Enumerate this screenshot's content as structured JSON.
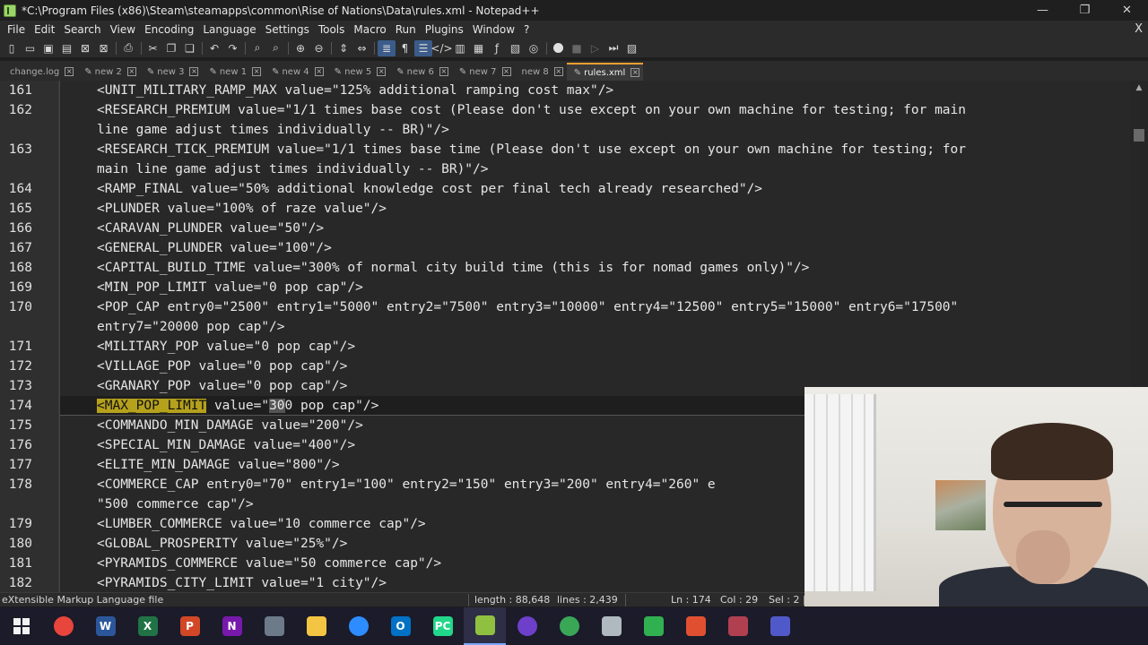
{
  "window": {
    "title": "*C:\\Program Files (x86)\\Steam\\steamapps\\common\\Rise of Nations\\Data\\rules.xml - Notepad++",
    "minimize": "—",
    "maximize": "❐",
    "close": "✕"
  },
  "menu": {
    "items": [
      "File",
      "Edit",
      "Search",
      "View",
      "Encoding",
      "Language",
      "Settings",
      "Tools",
      "Macro",
      "Run",
      "Plugins",
      "Window",
      "?"
    ],
    "close_doc": "X"
  },
  "toolbar": {
    "buttons": [
      {
        "name": "new-file",
        "glyph": "▯"
      },
      {
        "name": "open-file",
        "glyph": "▭"
      },
      {
        "name": "save",
        "glyph": "▣"
      },
      {
        "name": "save-all",
        "glyph": "▤"
      },
      {
        "name": "close",
        "glyph": "⊠"
      },
      {
        "name": "close-all",
        "glyph": "⊠"
      },
      {
        "name": "print",
        "glyph": "⎙"
      },
      {
        "name": "cut",
        "glyph": "✂"
      },
      {
        "name": "copy",
        "glyph": "❐"
      },
      {
        "name": "paste",
        "glyph": "❏"
      },
      {
        "name": "undo",
        "glyph": "↶"
      },
      {
        "name": "redo",
        "glyph": "↷"
      },
      {
        "name": "find",
        "glyph": "⌕"
      },
      {
        "name": "replace",
        "glyph": "⌕"
      },
      {
        "name": "zoom-in",
        "glyph": "⊕"
      },
      {
        "name": "zoom-out",
        "glyph": "⊖"
      },
      {
        "name": "sync-v",
        "glyph": "⇕"
      },
      {
        "name": "sync-h",
        "glyph": "⇔"
      },
      {
        "name": "word-wrap",
        "glyph": "≣"
      },
      {
        "name": "show-all",
        "glyph": "¶"
      },
      {
        "name": "indent-guide",
        "glyph": "☰"
      },
      {
        "name": "xml",
        "glyph": "</>"
      },
      {
        "name": "doc-map",
        "glyph": "▥"
      },
      {
        "name": "doc-list",
        "glyph": "▦"
      },
      {
        "name": "function-list",
        "glyph": "ƒ"
      },
      {
        "name": "folder-workspace",
        "glyph": "▧"
      },
      {
        "name": "monitor",
        "glyph": "◎"
      },
      {
        "name": "record-macro",
        "glyph": "●"
      },
      {
        "name": "stop-record",
        "glyph": "■"
      },
      {
        "name": "play-macro",
        "glyph": "▷"
      },
      {
        "name": "run-macro-multi",
        "glyph": "⏭"
      },
      {
        "name": "save-macro",
        "glyph": "▨"
      }
    ]
  },
  "tabs": [
    {
      "label": "change.log",
      "modified": false,
      "active": false
    },
    {
      "label": "new 2",
      "modified": true,
      "active": false
    },
    {
      "label": "new 3",
      "modified": true,
      "active": false
    },
    {
      "label": "new 1",
      "modified": true,
      "active": false
    },
    {
      "label": "new 4",
      "modified": true,
      "active": false
    },
    {
      "label": "new 5",
      "modified": true,
      "active": false
    },
    {
      "label": "new 6",
      "modified": true,
      "active": false
    },
    {
      "label": "new 7",
      "modified": true,
      "active": false
    },
    {
      "label": "new 8",
      "modified": false,
      "active": false
    },
    {
      "label": "rules.xml",
      "modified": true,
      "active": true
    }
  ],
  "editor": {
    "lines": [
      {
        "num": "161",
        "text": "<UNIT_MILITARY_RAMP_MAX value=\"125% additional ramping cost max\"/>"
      },
      {
        "num": "162",
        "text": "<RESEARCH_PREMIUM value=\"1/1 times base cost (Please don't use except on your own machine for testing; for main"
      },
      {
        "num": "",
        "text": "line game adjust times individually -- BR)\"/>"
      },
      {
        "num": "163",
        "text": "<RESEARCH_TICK_PREMIUM value=\"1/1 times base time (Please don't use except on your own machine for testing; for"
      },
      {
        "num": "",
        "text": "main line game adjust times individually -- BR)\"/>"
      },
      {
        "num": "164",
        "text": "<RAMP_FINAL value=\"50% additional knowledge cost per final tech already researched\"/>"
      },
      {
        "num": "165",
        "text": "<PLUNDER value=\"100% of raze value\"/>"
      },
      {
        "num": "166",
        "text": "<CARAVAN_PLUNDER value=\"50\"/>"
      },
      {
        "num": "167",
        "text": "<GENERAL_PLUNDER value=\"100\"/>"
      },
      {
        "num": "168",
        "text": "<CAPITAL_BUILD_TIME value=\"300% of normal city build time (this is for nomad games only)\"/>"
      },
      {
        "num": "169",
        "text": "<MIN_POP_LIMIT value=\"0 pop cap\"/>"
      },
      {
        "num": "170",
        "text": "<POP_CAP entry0=\"2500\" entry1=\"5000\" entry2=\"7500\" entry3=\"10000\" entry4=\"12500\" entry5=\"15000\" entry6=\"17500\""
      },
      {
        "num": "",
        "text": "entry7=\"20000 pop cap\"/>"
      },
      {
        "num": "171",
        "text": "<MILITARY_POP value=\"0 pop cap\"/>"
      },
      {
        "num": "172",
        "text": "<VILLAGE_POP value=\"0 pop cap\"/>"
      },
      {
        "num": "173",
        "text": "<GRANARY_POP value=\"0 pop cap\"/>"
      },
      {
        "num": "174",
        "text": "",
        "current": true
      },
      {
        "num": "175",
        "text": "<COMMANDO_MIN_DAMAGE value=\"200\"/>"
      },
      {
        "num": "176",
        "text": "<SPECIAL_MIN_DAMAGE value=\"400\"/>"
      },
      {
        "num": "177",
        "text": "<ELITE_MIN_DAMAGE value=\"800\"/>"
      },
      {
        "num": "178",
        "text": "<COMMERCE_CAP entry0=\"70\" entry1=\"100\" entry2=\"150\" entry3=\"200\" entry4=\"260\" e"
      },
      {
        "num": "",
        "text": "\"500 commerce cap\"/>"
      },
      {
        "num": "179",
        "text": "<LUMBER_COMMERCE value=\"10 commerce cap\"/>"
      },
      {
        "num": "180",
        "text": "<GLOBAL_PROSPERITY value=\"25%\"/>"
      },
      {
        "num": "181",
        "text": "<PYRAMIDS_COMMERCE value=\"50 commerce cap\"/>"
      },
      {
        "num": "182",
        "text": "<PYRAMIDS_CITY_LIMIT value=\"1 city\"/>"
      }
    ],
    "current_line": {
      "tag": "<MAX_POP_LIMIT",
      "attr_pre": " value=\"",
      "selected": "30",
      "cursor_char": "0",
      "rest": " pop cap\"/>"
    }
  },
  "status": {
    "language": "eXtensible Markup Language file",
    "length": "length : 88,648",
    "lines": "lines : 2,439",
    "ln": "Ln : 174",
    "col": "Col : 29",
    "sel": "Sel : 2 |"
  },
  "taskbar": {
    "apps": [
      {
        "name": "start",
        "label": ""
      },
      {
        "name": "chrome",
        "label": "",
        "color": "#e8453c"
      },
      {
        "name": "word",
        "label": "W",
        "color": "#2b579a"
      },
      {
        "name": "excel",
        "label": "X",
        "color": "#217346"
      },
      {
        "name": "powerpoint",
        "label": "P",
        "color": "#d24726"
      },
      {
        "name": "onenote",
        "label": "N",
        "color": "#7719aa"
      },
      {
        "name": "calculator",
        "label": "",
        "color": "#6c7a89"
      },
      {
        "name": "file-explorer",
        "label": "",
        "color": "#f4c542"
      },
      {
        "name": "zoom",
        "label": "",
        "color": "#2d8cff"
      },
      {
        "name": "outlook",
        "label": "O",
        "color": "#0072c6"
      },
      {
        "name": "pycharm",
        "label": "PC",
        "color": "#21d789"
      },
      {
        "name": "notepadpp",
        "label": "",
        "color": "#90c040"
      },
      {
        "name": "github",
        "label": "",
        "color": "#6e40c9"
      },
      {
        "name": "browser-green",
        "label": "",
        "color": "#3aa757"
      },
      {
        "name": "app-grey",
        "label": "",
        "color": "#b0b8c0"
      },
      {
        "name": "camtasia",
        "label": "",
        "color": "#30b050"
      },
      {
        "name": "app-red",
        "label": "",
        "color": "#e05030"
      },
      {
        "name": "app-portrait",
        "label": "",
        "color": "#b04050"
      },
      {
        "name": "teams",
        "label": "",
        "color": "#5059c9"
      }
    ]
  }
}
